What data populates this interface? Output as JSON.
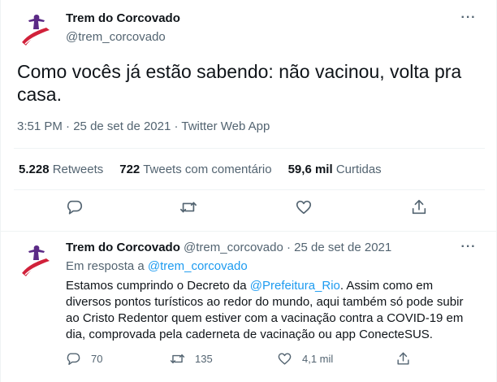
{
  "colors": {
    "link": "#1d9bf0",
    "text": "#0f1419",
    "secondary": "#536471",
    "logo_red": "#d1213a",
    "logo_purple": "#5b2a86"
  },
  "main_tweet": {
    "display_name": "Trem do Corcovado",
    "handle": "@trem_corcovado",
    "more_icon": "more-horizontal-icon",
    "text": "Como vocês já estão sabendo: não vacinou, volta pra casa.",
    "time": "3:51 PM",
    "sep1": " · ",
    "date": "25 de set de 2021",
    "sep2": " · ",
    "source": "Twitter Web App",
    "stats": {
      "retweets_count": "5.228",
      "retweets_label": "Retweets",
      "quotes_count": "722",
      "quotes_label": "Tweets com comentário",
      "likes_count": "59,6 mil",
      "likes_label": "Curtidas"
    },
    "actions": [
      "reply-icon",
      "retweet-icon",
      "like-icon",
      "share-icon"
    ]
  },
  "reply_tweet": {
    "display_name": "Trem do Corcovado",
    "handle_date": "@trem_corcovado · 25 de set de 2021",
    "in_reply_prefix": "Em resposta a ",
    "in_reply_handle": "@trem_corcovado",
    "text_part1": "Estamos cumprindo o Decreto da ",
    "mention": "@Prefeitura_Rio",
    "text_part2": ". Assim como em diversos pontos turísticos ao redor do mundo, aqui também só pode subir ao Cristo Redentor quem estiver com a vacinação contra a COVID-19 em dia, comprovada pela caderneta de vacinação ou app ConecteSUS.",
    "counts": {
      "replies": "70",
      "retweets": "135",
      "likes": "4,1 mil"
    }
  }
}
